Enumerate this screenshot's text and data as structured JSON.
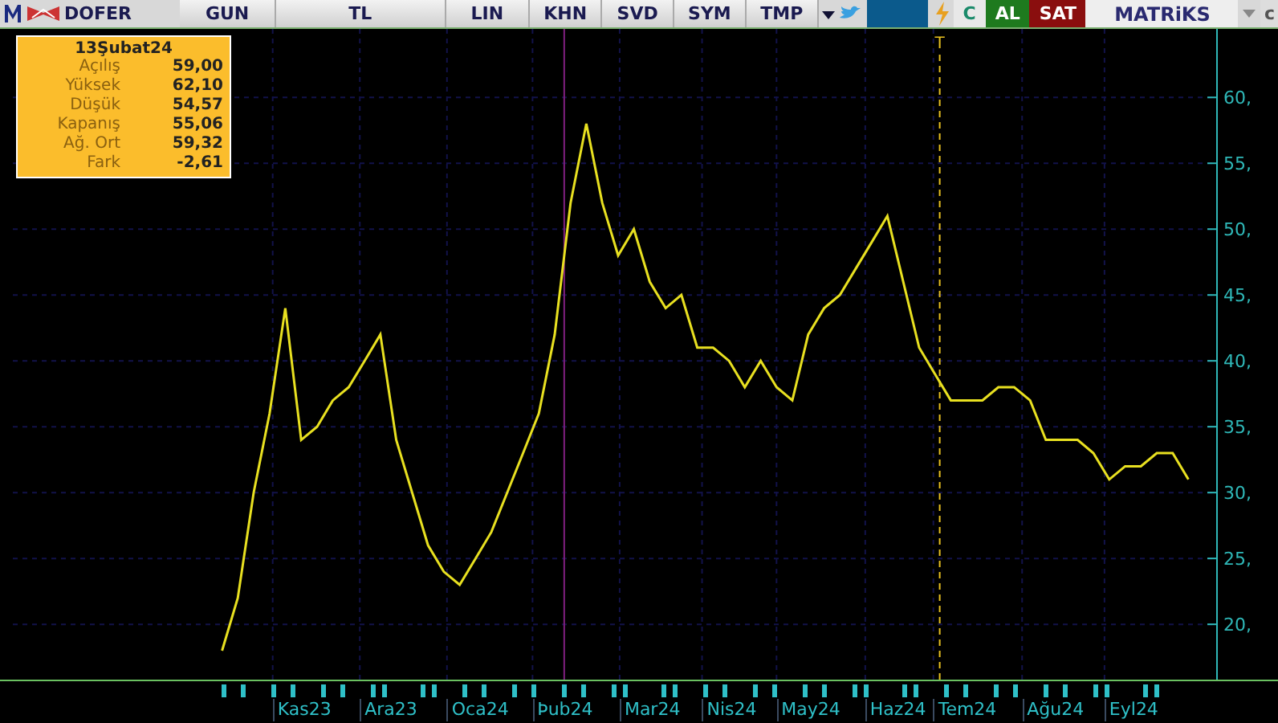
{
  "toolbar": {
    "symbol": "DOFER",
    "buttons": [
      "GUN",
      "TL",
      "LIN",
      "KHN",
      "SVD",
      "SYM",
      "TMP"
    ],
    "refresh_label": "C",
    "buy_label": "AL",
    "sell_label": "SAT",
    "brand": "MATRiKS",
    "edge_label": "c"
  },
  "info_box": {
    "date": "13Şubat24",
    "rows": [
      {
        "label": "Açılış",
        "value": "59,00"
      },
      {
        "label": "Yüksek",
        "value": "62,10"
      },
      {
        "label": "Düşük",
        "value": "54,57"
      },
      {
        "label": "Kapanış",
        "value": "55,06"
      },
      {
        "label": "Ağ. Ort",
        "value": "59,32"
      },
      {
        "label": "Fark",
        "value": "-2,61"
      }
    ]
  },
  "chart": {
    "marker_label": "T",
    "months": [
      "Kas23",
      "Ara23",
      "Oca24",
      "Þub24",
      "Mar24",
      "Nis24",
      "May24",
      "Haz24",
      "Tem24",
      "Ağu24",
      "Eyl24"
    ],
    "chart_data": {
      "type": "line",
      "grid": true,
      "ylim": [
        15.8,
        65.2
      ],
      "yticks": [
        {
          "value": 20,
          "label": "20,"
        },
        {
          "value": 25,
          "label": "25,"
        },
        {
          "value": 30,
          "label": "30,"
        },
        {
          "value": 35,
          "label": "35,"
        },
        {
          "value": 40,
          "label": "40,"
        },
        {
          "value": 45,
          "label": "45,"
        },
        {
          "value": 50,
          "label": "50,"
        },
        {
          "value": 55,
          "label": "55,"
        },
        {
          "value": 60,
          "label": "60,"
        }
      ],
      "series": [
        {
          "color": "#e8e020",
          "values": [
            18,
            22,
            30,
            36,
            44,
            34,
            35,
            37,
            38,
            40,
            42,
            34,
            30,
            26,
            24,
            23,
            25,
            27,
            30,
            33,
            36,
            42,
            52,
            58,
            52,
            48,
            50,
            46,
            44,
            45,
            41,
            41,
            40,
            38,
            40,
            38,
            37,
            42,
            44,
            45,
            47,
            49,
            51,
            46,
            41,
            39,
            37,
            37,
            37,
            38,
            38,
            37,
            34,
            34,
            34,
            33,
            31,
            32,
            32,
            33,
            33,
            31
          ]
        }
      ]
    }
  }
}
